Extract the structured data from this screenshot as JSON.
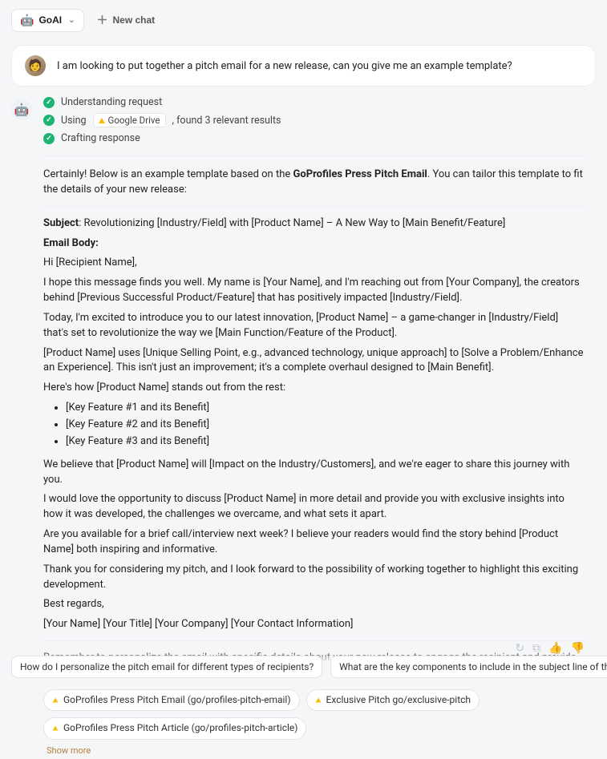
{
  "header": {
    "app_label": "GoAI",
    "new_chat_label": "New chat"
  },
  "user_message": "I am looking to put together a pitch email for a new release, can you give me an example template?",
  "steps": {
    "s1": "Understanding request",
    "s2_pre": "Using",
    "s2_chip": "Google Drive",
    "s2_post": ", found 3 relevant results",
    "s3": "Crafting response"
  },
  "response": {
    "intro_a": "Certainly! Below is an example template based on the ",
    "intro_bold": "GoProfiles Press Pitch Email",
    "intro_b": ". You can tailor this template to fit the details of your new release:",
    "subject_label": "Subject",
    "subject_value": ": Revolutionizing [Industry/Field] with [Product Name] – A New Way to [Main Benefit/Feature]",
    "body_label": "Email Body:",
    "greeting": "Hi [Recipient Name],",
    "p1": "I hope this message finds you well. My name is [Your Name], and I'm reaching out from [Your Company], the creators behind [Previous Successful Product/Feature] that has positively impacted [Industry/Field].",
    "p2": "Today, I'm excited to introduce you to our latest innovation, [Product Name] – a game-changer in [Industry/Field] that's set to revolutionize the way we [Main Function/Feature of the Product].",
    "p3": "[Product Name] uses [Unique Selling Point, e.g., advanced technology, unique approach] to [Solve a Problem/Enhance an Experience]. This isn't just an improvement; it's a complete overhaul designed to [Main Benefit].",
    "p4": "Here's how [Product Name] stands out from the rest:",
    "features": [
      "[Key Feature #1 and its Benefit]",
      "[Key Feature #2 and its Benefit]",
      "[Key Feature #3 and its Benefit]"
    ],
    "p5": "We believe that [Product Name] will [Impact on the Industry/Customers], and we're eager to share this journey with you.",
    "p6": "I would love the opportunity to discuss [Product Name] in more detail and provide you with exclusive insights into how it was developed, the challenges we overcame, and what sets it apart.",
    "p7": "Are you available for a brief call/interview next week? I believe your readers would find the story behind [Product Name] both inspiring and informative.",
    "p8": "Thank you for considering my pitch, and I look forward to the possibility of working together to highlight this exciting development.",
    "signoff": "Best regards,",
    "sig": "[Your Name] [Your Title] [Your Company] [Your Contact Information]",
    "outro": "Remember to personalize the email with specific details about your new release to engage the recipient and provide clear insights into what makes your product exciting and valuable."
  },
  "sources": [
    "GoProfiles Press Pitch Email (go/profiles-pitch-email)",
    "Exclusive Pitch go/exclusive-pitch",
    "GoProfiles Press Pitch Article (go/profiles-pitch-article)"
  ],
  "show_more": "Show more",
  "suggestions": [
    "How do I personalize the pitch email for different types of recipients?",
    "What are the key components to include in the subject line of the pitch email?"
  ]
}
